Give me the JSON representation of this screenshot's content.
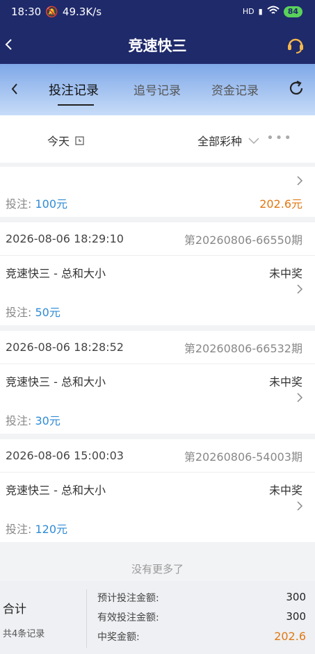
{
  "status": {
    "time": "18:30",
    "speed": "49.3K/s",
    "net": "HD",
    "battery": "84"
  },
  "header": {
    "title": "竞速快三"
  },
  "tabs": [
    {
      "label": "投注记录",
      "active": true
    },
    {
      "label": "追号记录",
      "active": false
    },
    {
      "label": "资金记录",
      "active": false
    }
  ],
  "filters": {
    "date": "今天",
    "lottery": "全部彩种",
    "more": "•••"
  },
  "stake_label": "投注: ",
  "records": [
    {
      "stake": "100元",
      "prize": "202.6元"
    },
    {
      "datetime": "2026-08-06 18:29:10",
      "issue": "第20260806-66550期",
      "game": "竞速快三 - 总和大小",
      "result": "未中奖",
      "stake": "50元"
    },
    {
      "datetime": "2026-08-06 18:28:52",
      "issue": "第20260806-66532期",
      "game": "竞速快三 - 总和大小",
      "result": "未中奖",
      "stake": "30元"
    },
    {
      "datetime": "2026-08-06 15:00:03",
      "issue": "第20260806-54003期",
      "game": "竞速快三 - 总和大小",
      "result": "未中奖",
      "stake": "120元"
    }
  ],
  "no_more": "没有更多了",
  "summary": {
    "title": "合计",
    "count": "共4条记录",
    "lines": [
      {
        "label": "预计投注金额:",
        "value": "300"
      },
      {
        "label": "有效投注金额:",
        "value": "300"
      },
      {
        "label": "中奖金额:",
        "value": "202.6"
      }
    ]
  },
  "colors": {
    "nav": "#1f2a6b",
    "stake_amount": "#2e8bd6",
    "prize": "#e07812"
  }
}
